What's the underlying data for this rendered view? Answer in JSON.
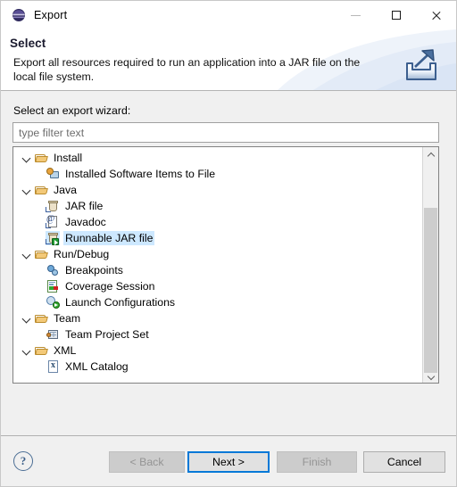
{
  "window": {
    "title": "Export",
    "app_icon": "eclipse-icon",
    "controls": {
      "minimize": "–",
      "maximize": "□",
      "close": "×"
    }
  },
  "banner": {
    "title": "Select",
    "description": "Export all resources required to run an application into a JAR file on the local file system.",
    "icon": "export-banner-icon"
  },
  "form": {
    "wizard_label": "Select an export wizard:",
    "filter_placeholder": "type filter text",
    "filter_value": ""
  },
  "tree": {
    "selected": "Runnable JAR file",
    "nodes": [
      {
        "label": "Install",
        "type": "folder",
        "icon": "folder-icon",
        "expanded": true,
        "depth": 0,
        "selected": false
      },
      {
        "label": "Installed Software Items to File",
        "type": "leaf",
        "icon": "software-icon",
        "expanded": false,
        "depth": 1,
        "selected": false
      },
      {
        "label": "Java",
        "type": "folder",
        "icon": "folder-icon",
        "expanded": true,
        "depth": 0,
        "selected": false
      },
      {
        "label": "JAR file",
        "type": "leaf",
        "icon": "jar-icon",
        "expanded": false,
        "depth": 1,
        "selected": false
      },
      {
        "label": "Javadoc",
        "type": "leaf",
        "icon": "javadoc-icon",
        "expanded": false,
        "depth": 1,
        "selected": false
      },
      {
        "label": "Runnable JAR file",
        "type": "leaf",
        "icon": "runnable-jar-icon",
        "expanded": false,
        "depth": 1,
        "selected": true
      },
      {
        "label": "Run/Debug",
        "type": "folder",
        "icon": "folder-icon",
        "expanded": true,
        "depth": 0,
        "selected": false
      },
      {
        "label": "Breakpoints",
        "type": "leaf",
        "icon": "breakpoint-icon",
        "expanded": false,
        "depth": 1,
        "selected": false
      },
      {
        "label": "Coverage Session",
        "type": "leaf",
        "icon": "coverage-icon",
        "expanded": false,
        "depth": 1,
        "selected": false
      },
      {
        "label": "Launch Configurations",
        "type": "leaf",
        "icon": "launch-icon",
        "expanded": false,
        "depth": 1,
        "selected": false
      },
      {
        "label": "Team",
        "type": "folder",
        "icon": "folder-icon",
        "expanded": true,
        "depth": 0,
        "selected": false
      },
      {
        "label": "Team Project Set",
        "type": "leaf",
        "icon": "team-icon",
        "expanded": false,
        "depth": 1,
        "selected": false
      },
      {
        "label": "XML",
        "type": "folder",
        "icon": "folder-icon",
        "expanded": true,
        "depth": 0,
        "selected": false
      },
      {
        "label": "XML Catalog",
        "type": "leaf",
        "icon": "xml-icon",
        "expanded": false,
        "depth": 1,
        "selected": false
      }
    ],
    "scrollbar": {
      "up_arrow": "chevron-up-icon",
      "down_arrow": "chevron-down-icon",
      "thumb_top_pct": 27,
      "thumb_height_pct": 74
    }
  },
  "footer": {
    "help_label": "?",
    "buttons": [
      {
        "id": "back",
        "label": "< Back",
        "enabled": false,
        "focused": false
      },
      {
        "id": "next",
        "label": "Next >",
        "enabled": true,
        "focused": true
      },
      {
        "id": "finish",
        "label": "Finish",
        "enabled": false,
        "focused": false
      },
      {
        "id": "cancel",
        "label": "Cancel",
        "enabled": true,
        "focused": false
      }
    ]
  },
  "colors": {
    "focus_blue": "#0078d7",
    "selection_blue": "#cde8ff",
    "dialog_bg": "#f0f0f0",
    "banner_bg": "#ffffff",
    "tree_bg": "#ffffff"
  }
}
